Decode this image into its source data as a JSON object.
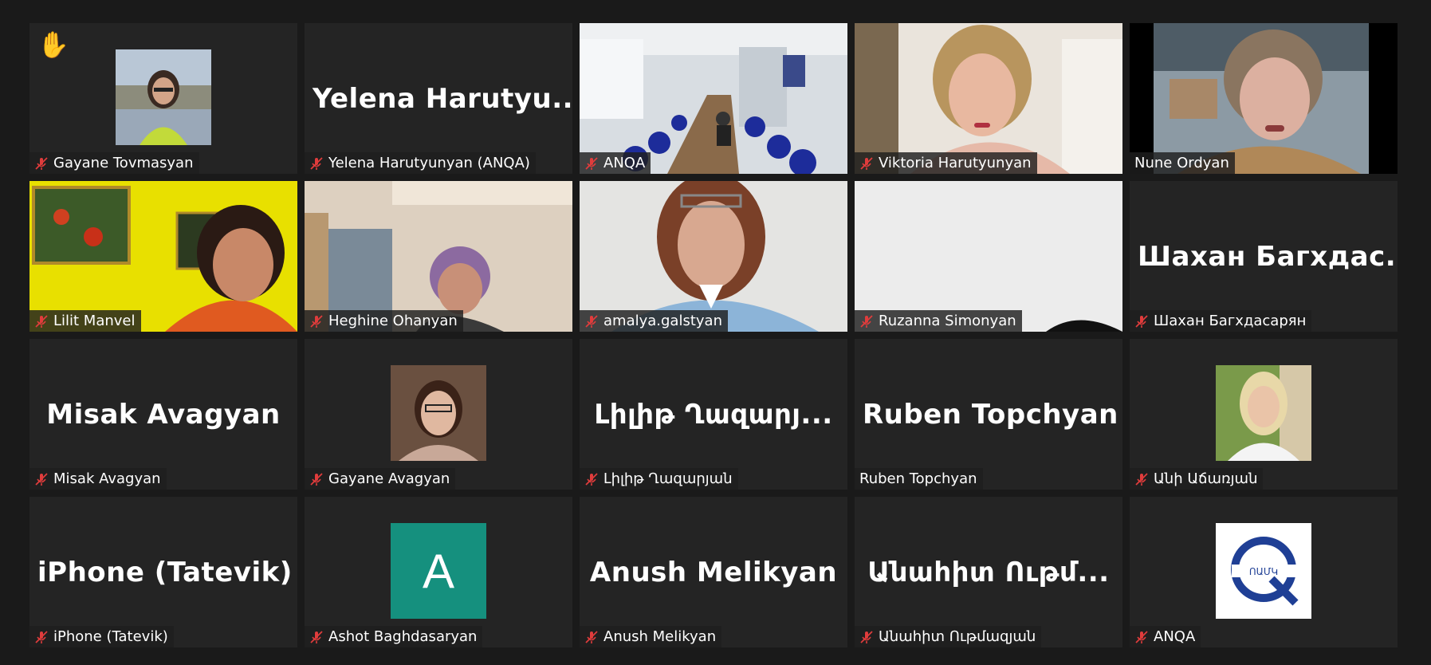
{
  "participants": [
    {
      "name": "Gayane Tovmasyan",
      "muted": true,
      "hand": true,
      "kind": "avatar"
    },
    {
      "name": "Yelena Harutyunyan (ANQA)",
      "display": "Yelena  Harutyu...",
      "muted": true,
      "kind": "text"
    },
    {
      "name": "ANQA",
      "muted": true,
      "kind": "video"
    },
    {
      "name": "Viktoria Harutyunyan",
      "muted": true,
      "kind": "video"
    },
    {
      "name": "Nune Ordyan",
      "muted": false,
      "active": true,
      "kind": "video"
    },
    {
      "name": "Lilit Manvel",
      "muted": true,
      "kind": "video"
    },
    {
      "name": "Heghine Ohanyan",
      "muted": true,
      "kind": "video"
    },
    {
      "name": "amalya.galstyan",
      "muted": true,
      "kind": "video"
    },
    {
      "name": "Ruzanna Simonyan",
      "muted": true,
      "kind": "video"
    },
    {
      "name": "Шахан Багхдасарян",
      "display": "Шахан  Багхдас...",
      "muted": true,
      "kind": "text"
    },
    {
      "name": "Misak Avagyan",
      "display": "Misak Avagyan",
      "muted": true,
      "kind": "text"
    },
    {
      "name": "Gayane Avagyan",
      "muted": true,
      "kind": "avatar"
    },
    {
      "name": "Լիլիթ Ղազարյան",
      "display": "Լիլիթ  Ղազարյ...",
      "muted": true,
      "kind": "text"
    },
    {
      "name": "Ruben Topchyan",
      "display": "Ruben Topchyan",
      "muted": false,
      "kind": "text"
    },
    {
      "name": "Անի Աճառյան",
      "muted": true,
      "kind": "avatar"
    },
    {
      "name": "iPhone (Tatevik)",
      "display": "iPhone (Tatevik)",
      "muted": true,
      "kind": "text"
    },
    {
      "name": "Ashot Baghdasaryan",
      "muted": true,
      "kind": "letter",
      "letter": "A"
    },
    {
      "name": "Anush Melikyan",
      "display": "Anush Melikyan",
      "muted": true,
      "kind": "text"
    },
    {
      "name": "Անահիտ Ութմազյան",
      "display": "Անահիտ  Ութմ...",
      "muted": true,
      "kind": "text"
    },
    {
      "name": "ANQA",
      "muted": true,
      "kind": "logo",
      "logo_text": "ՈԱՄԿ"
    }
  ],
  "colors": {
    "tile": "#242424",
    "active_border": "#d9ec86",
    "muted_icon": "#e03c3c",
    "avatar_letter_bg": "#15907e"
  },
  "icons": {
    "muted": "mic-muted-icon",
    "raise_hand": "raised-hand-icon"
  }
}
